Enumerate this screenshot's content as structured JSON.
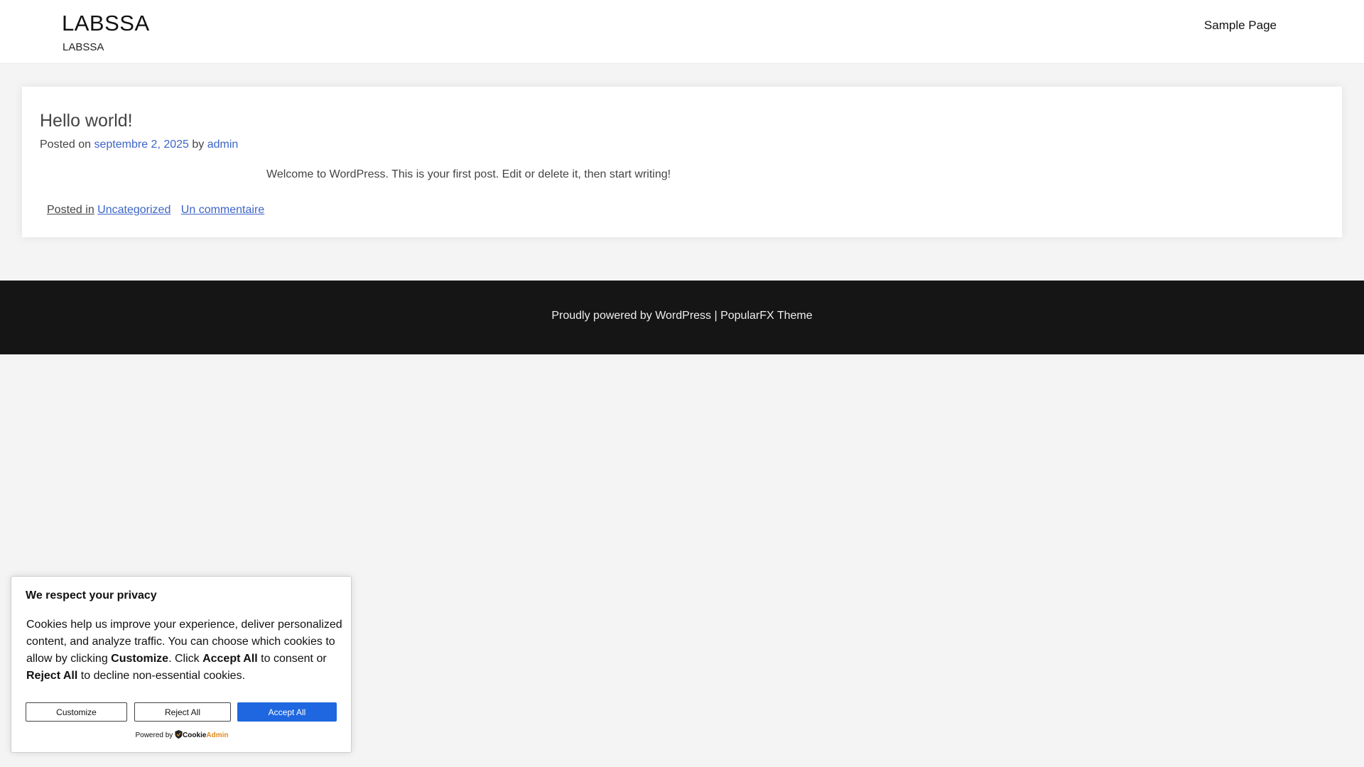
{
  "header": {
    "site_title": "LABSSA",
    "site_description": "LABSSA",
    "nav": [
      {
        "label": "Sample Page"
      }
    ]
  },
  "post": {
    "title": "Hello world!",
    "posted_on_label": "Posted on",
    "date": "septembre 2, 2025",
    "by_label": "by",
    "author": "admin",
    "content": "Welcome to WordPress. This is your first post. Edit or delete it, then start writing!",
    "posted_in_label": "Posted in",
    "category": "Uncategorized",
    "comments_link": "Un commentaire"
  },
  "footer": {
    "text": "Proudly powered by WordPress | PopularFX Theme"
  },
  "cookie": {
    "title": "We respect your privacy",
    "text_1": "Cookies help us improve your experience, deliver personalized content, and analyze traffic. You can choose which cookies to allow by clicking ",
    "customize_word": "Customize",
    "text_2": ". Click ",
    "accept_word": "Accept All",
    "text_3": " to consent or ",
    "reject_word": "Reject All",
    "text_4": " to decline non-essential cookies.",
    "buttons": {
      "customize": "Customize",
      "reject": "Reject All",
      "accept": "Accept All"
    },
    "powered_by": "Powered by",
    "brand_1": "Cookie",
    "brand_2": "Admin",
    "accent_color": "#1e67e0"
  }
}
